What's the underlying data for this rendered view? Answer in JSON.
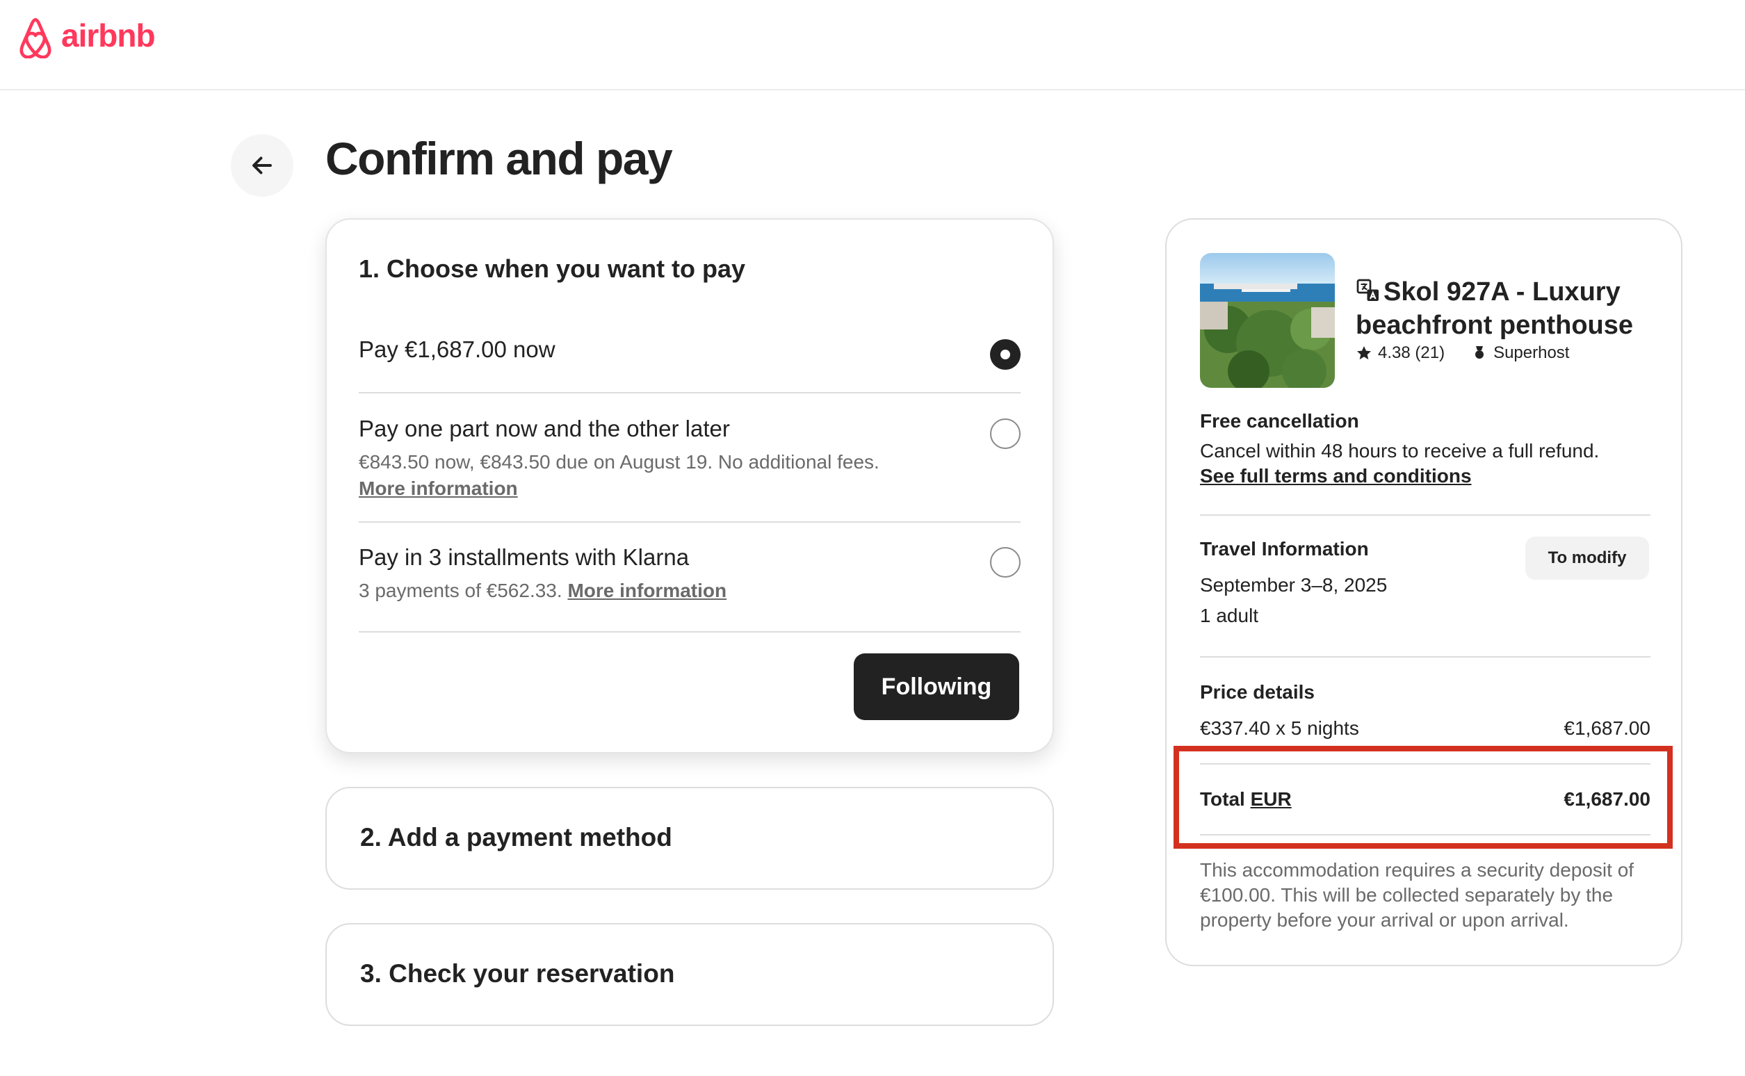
{
  "header": {
    "brand": "airbnb",
    "brand_color": "#FF385C"
  },
  "page": {
    "title": "Confirm and pay",
    "back_icon": "arrow-left-icon"
  },
  "step1": {
    "title": "1. Choose when you want to pay",
    "options": [
      {
        "label": "Pay €1,687.00 now",
        "selected": true
      },
      {
        "label": "Pay one part now and the other later",
        "sub": "€843.50 now, €843.50 due on August 19. No additional fees.",
        "link": "More information",
        "selected": false
      },
      {
        "label": "Pay in 3 installments with Klarna",
        "sub": "3 payments of €562.33.",
        "link": "More information",
        "selected": false
      }
    ],
    "next_label": "Following"
  },
  "step2": {
    "title": "2. Add a payment method"
  },
  "step3": {
    "title": "3. Check your reservation"
  },
  "summary": {
    "listing_title": "Skol 927A - Luxury beachfront penthouse",
    "rating": "4.38 (21)",
    "superhost": "Superhost",
    "cancellation": {
      "label": "Free cancellation",
      "text": "Cancel within 48 hours to receive a full refund.",
      "link": "See full terms and conditions"
    },
    "travel": {
      "label": "Travel Information",
      "dates": "September 3–8, 2025",
      "guests": "1 adult",
      "modify_label": "To modify"
    },
    "price": {
      "label": "Price details",
      "line_label": "€337.40 x 5 nights",
      "line_value": "€1,687.00",
      "total_label": "Total",
      "currency": "EUR",
      "total_value": "€1,687.00"
    },
    "deposit_note": "This accommodation requires a security deposit of €100.00. This will be collected separately by the property before your arrival or upon arrival."
  },
  "highlight_color": "#d3311f"
}
